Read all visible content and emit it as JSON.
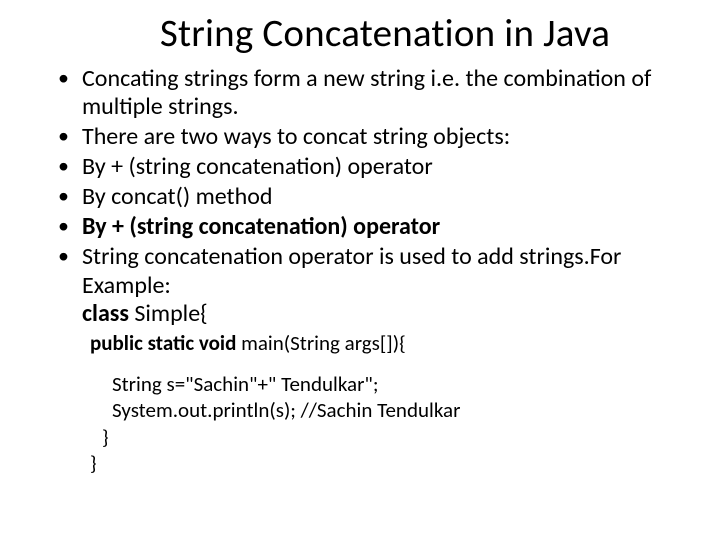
{
  "slide": {
    "title": "String Concatenation in Java",
    "bullets": {
      "b0": "Concating strings form a new string i.e. the combination of multiple strings.",
      "b1": "There are two ways to concat string objects:",
      "b2": "By + (string concatenation) operator",
      "b3": "By concat() method",
      "b4": "By + (string concatenation) operator",
      "b5_a": "String concatenation operator is used to add strings.For Example:",
      "b5_class_kw": "class",
      "b5_class_nm": " Simple{"
    },
    "code": {
      "l1_a": "public static void",
      "l1_b": " main(String args[]){",
      "l2": "String s=\"Sachin\"+\" Tendulkar\";",
      "l3": "System.out.println(s); //Sachin Tendulkar",
      "l4": "}",
      "l5": "}"
    }
  }
}
